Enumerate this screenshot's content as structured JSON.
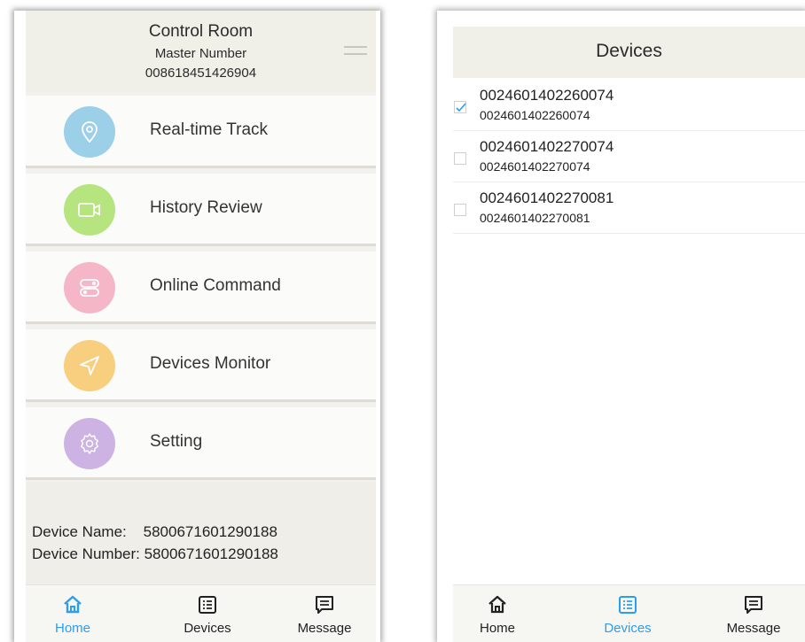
{
  "left": {
    "header": {
      "title": "Control Room",
      "subtitle": "Master Number",
      "number": "008618451426904"
    },
    "menu": [
      {
        "label": "Real-time Track",
        "icon": "location-pin-icon",
        "color": "#9ccfe8"
      },
      {
        "label": "History Review",
        "icon": "video-camera-icon",
        "color": "#b6e47f"
      },
      {
        "label": "Online Command",
        "icon": "toggle-switch-icon",
        "color": "#f5b7c8"
      },
      {
        "label": "Devices Monitor",
        "icon": "navigation-arrow-icon",
        "color": "#f7cf7f"
      },
      {
        "label": "Setting",
        "icon": "gear-icon",
        "color": "#cdb3e3"
      }
    ],
    "info": {
      "device_name": "Device Name:    5800671601290188",
      "device_number": "Device Number: 5800671601290188"
    },
    "tabs": [
      {
        "label": "Home",
        "icon": "home-icon",
        "active": true
      },
      {
        "label": "Devices",
        "icon": "list-icon",
        "active": false
      },
      {
        "label": "Message",
        "icon": "message-icon",
        "active": false
      }
    ]
  },
  "right": {
    "header": {
      "title": "Devices"
    },
    "devices": [
      {
        "name": "0024601402260074",
        "number": "0024601402260074",
        "checked": true
      },
      {
        "name": "0024601402270074",
        "number": "0024601402270074",
        "checked": false
      },
      {
        "name": "0024601402270081",
        "number": "0024601402270081",
        "checked": false
      }
    ],
    "tabs": [
      {
        "label": "Home",
        "icon": "home-icon",
        "active": false
      },
      {
        "label": "Devices",
        "icon": "list-icon",
        "active": true
      },
      {
        "label": "Message",
        "icon": "message-icon",
        "active": false
      }
    ]
  },
  "colors": {
    "accent": "#2b9ef0",
    "header_bg": "#f0efe8"
  }
}
